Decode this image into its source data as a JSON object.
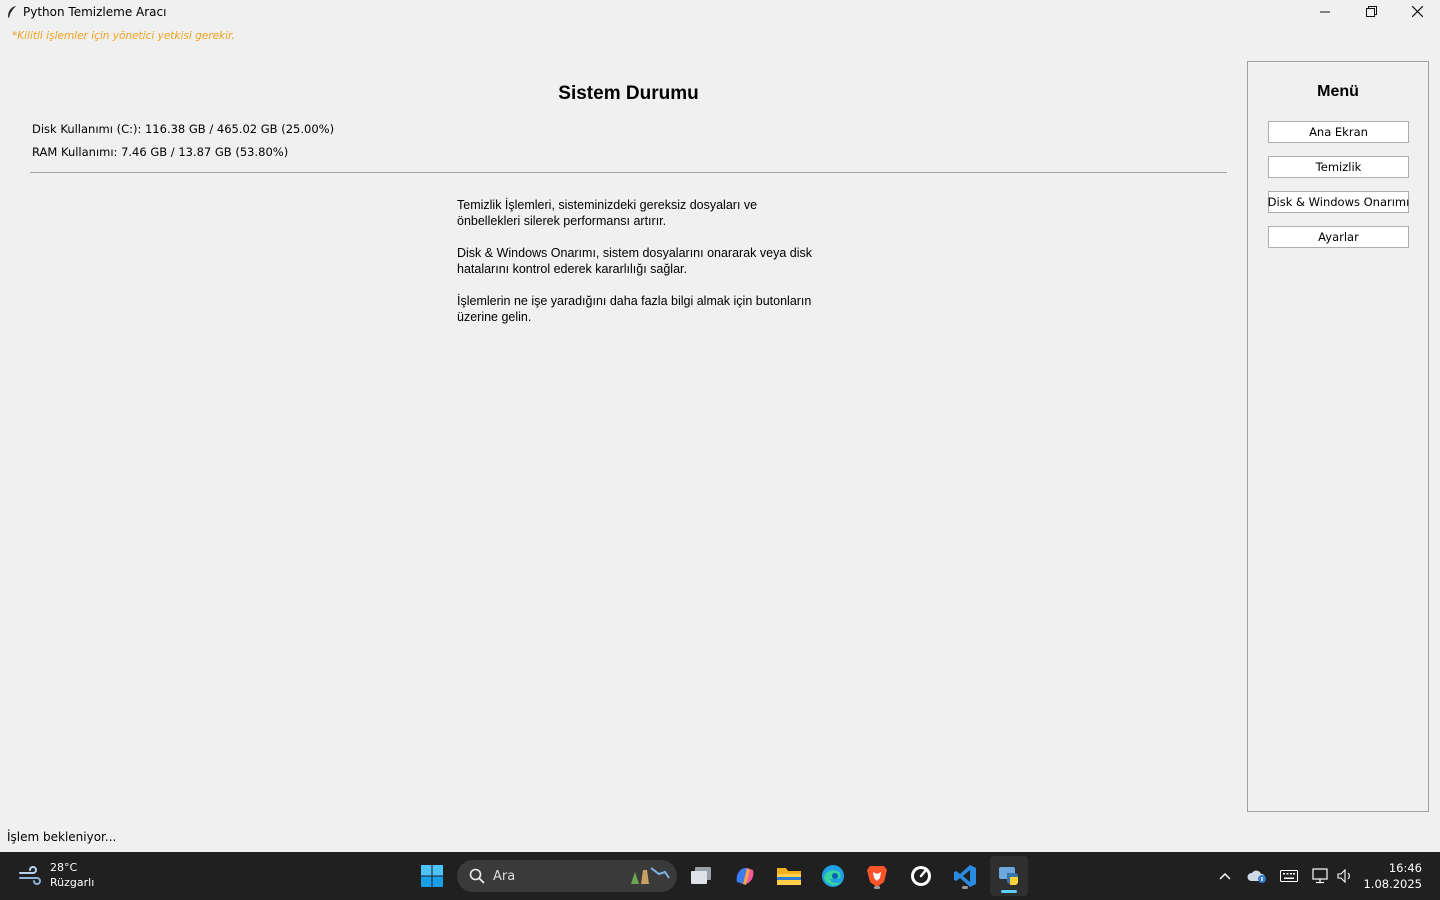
{
  "window": {
    "title": "Python Temizleme Aracı"
  },
  "warning": "*Kilitli işlemler için yönetici yetkisi gerekir.",
  "main": {
    "title": "Sistem Durumu",
    "disk_usage": "Disk Kullanımı (C:): 116.38 GB / 465.02 GB (25.00%)",
    "ram_usage": "RAM Kullanımı: 7.46 GB / 13.87 GB (53.80%)",
    "info": [
      "Temizlik İşlemleri, sisteminizdeki gereksiz dosyaları ve önbellekleri silerek performansı artırır.",
      "Disk & Windows Onarımı, sistem dosyalarını onararak veya disk hatalarını kontrol ederek kararlılığı sağlar.",
      "İşlemlerin ne işe yaradığını daha fazla bilgi almak için butonların üzerine gelin."
    ]
  },
  "menu": {
    "title": "Menü",
    "items": [
      {
        "label": "Ana Ekran"
      },
      {
        "label": "Temizlik"
      },
      {
        "label": "Disk & Windows Onarımı"
      },
      {
        "label": "Ayarlar"
      }
    ]
  },
  "status": "İşlem bekleniyor...",
  "taskbar": {
    "weather_temp": "28°C",
    "weather_desc": "Rüzgarlı",
    "search_placeholder": "Ara",
    "time": "16:46",
    "date": "1.08.2025"
  }
}
